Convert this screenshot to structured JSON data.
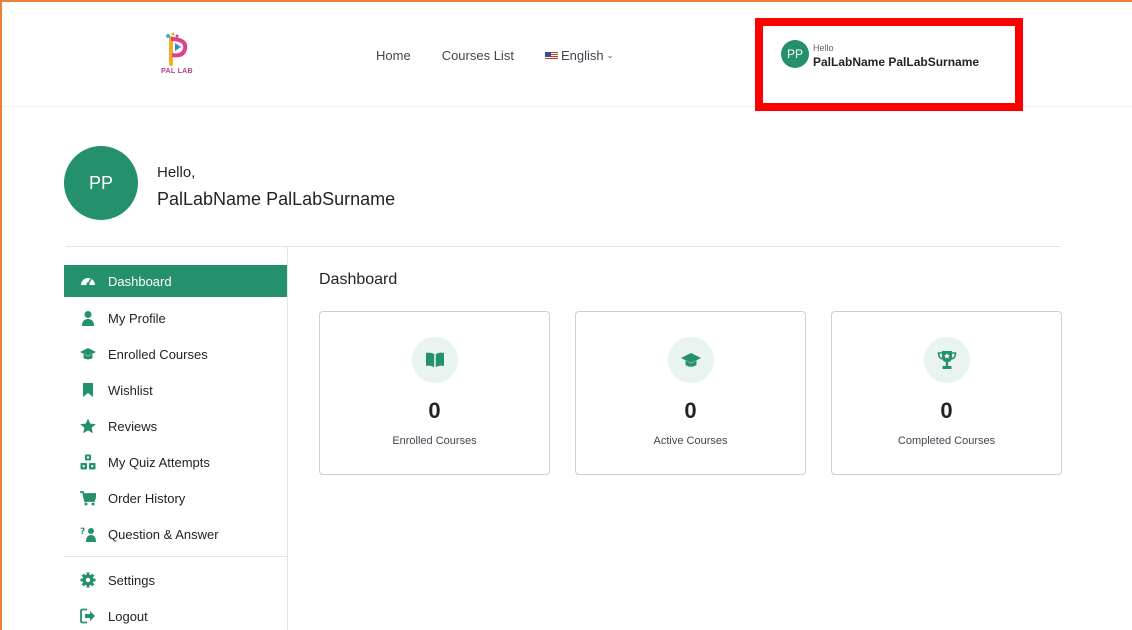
{
  "brand": {
    "logo_text": "PAL LAB"
  },
  "nav": {
    "home": "Home",
    "courses_list": "Courses List",
    "language": "English"
  },
  "user": {
    "initials": "PP",
    "greeting_short": "Hello",
    "greeting": "Hello,",
    "full_name": "PalLabName PalLabSurname"
  },
  "sidebar": {
    "items": [
      {
        "label": "Dashboard",
        "icon": "dashboard-icon",
        "active": true
      },
      {
        "label": "My Profile",
        "icon": "user-icon"
      },
      {
        "label": "Enrolled Courses",
        "icon": "graduation-cap-icon"
      },
      {
        "label": "Wishlist",
        "icon": "bookmark-icon"
      },
      {
        "label": "Reviews",
        "icon": "star-icon"
      },
      {
        "label": "My Quiz Attempts",
        "icon": "quiz-icon"
      },
      {
        "label": "Order History",
        "icon": "cart-icon"
      },
      {
        "label": "Question & Answer",
        "icon": "question-answer-icon"
      },
      {
        "label": "Settings",
        "icon": "gear-icon"
      },
      {
        "label": "Logout",
        "icon": "logout-icon"
      }
    ]
  },
  "main": {
    "title": "Dashboard",
    "cards": [
      {
        "value": "0",
        "label": "Enrolled Courses",
        "icon": "book-icon"
      },
      {
        "value": "0",
        "label": "Active Courses",
        "icon": "graduation-cap-icon"
      },
      {
        "value": "0",
        "label": "Completed Courses",
        "icon": "trophy-icon"
      }
    ]
  },
  "colors": {
    "accent": "#24906d",
    "highlight_box": "#ff0000",
    "frame": "#e8823a",
    "icon_bg": "#e9f3ef"
  }
}
